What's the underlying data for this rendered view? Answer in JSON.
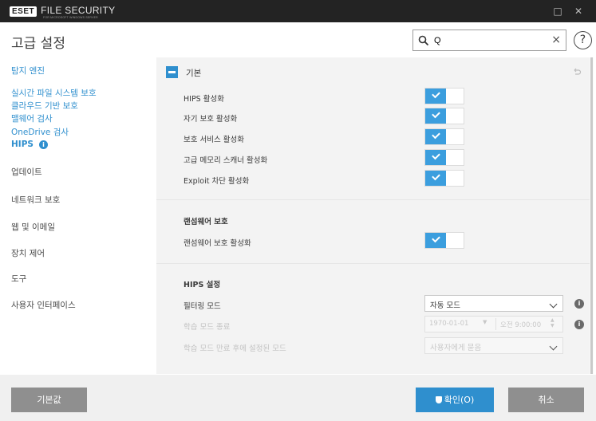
{
  "window": {
    "logo_text": "ESET",
    "product_name": "FILE SECURITY",
    "product_subtitle": "FOR MICROSOFT WINDOWS SERVER",
    "minimize_glyph": "□",
    "close_glyph": "✕"
  },
  "header": {
    "title": "고급 설정",
    "search": {
      "value": "Q",
      "placeholder": ""
    },
    "clear_glyph": "×",
    "help_glyph": "?"
  },
  "sidebar": {
    "items": [
      {
        "label": "탐지 엔진"
      },
      {
        "label": "실시간 파일 시스템 보호"
      },
      {
        "label": "클라우드 기반 보호"
      },
      {
        "label": "맬웨어 검사"
      },
      {
        "label": "OneDrive 검사"
      },
      {
        "label": "HIPS"
      },
      {
        "label": "업데이트"
      },
      {
        "label": "네트워크 보호"
      },
      {
        "label": "웹 및 이메일"
      },
      {
        "label": "장치 제어"
      },
      {
        "label": "도구"
      },
      {
        "label": "사용자 인터페이스"
      }
    ],
    "hips_badge": "i"
  },
  "section": {
    "title": "기본",
    "toggles": [
      {
        "label": "HIPS 활성화",
        "on": true
      },
      {
        "label": "자기 보호 활성화",
        "on": true
      },
      {
        "label": "보호 서비스 활성화",
        "on": true
      },
      {
        "label": "고급 메모리 스캐너 활성화",
        "on": true
      },
      {
        "label": "Exploit 차단 활성화",
        "on": true
      }
    ],
    "ransomware": {
      "title": "랜섬웨어 보호",
      "toggle_label": "랜섬웨어 보호 활성화",
      "on": true
    },
    "hips_settings": {
      "title": "HIPS 설정",
      "filter_label": "필터링 모드",
      "filter_value": "자동 모드",
      "learning_end_label": "학습 모드 종료",
      "learning_date": "1970-01-01",
      "learning_time": "오전 9:00:00",
      "after_learning_label": "학습 모드 만료 후에 설정된 모드",
      "after_learning_value": "사용자에게 묻음",
      "info_glyph": "i"
    }
  },
  "footer": {
    "default_label": "기본값",
    "ok_label": "확인(O)",
    "cancel_label": "취소"
  },
  "colors": {
    "accent": "#2f8fce",
    "titlebar": "#232323",
    "button_grey": "#8f8f8f"
  }
}
